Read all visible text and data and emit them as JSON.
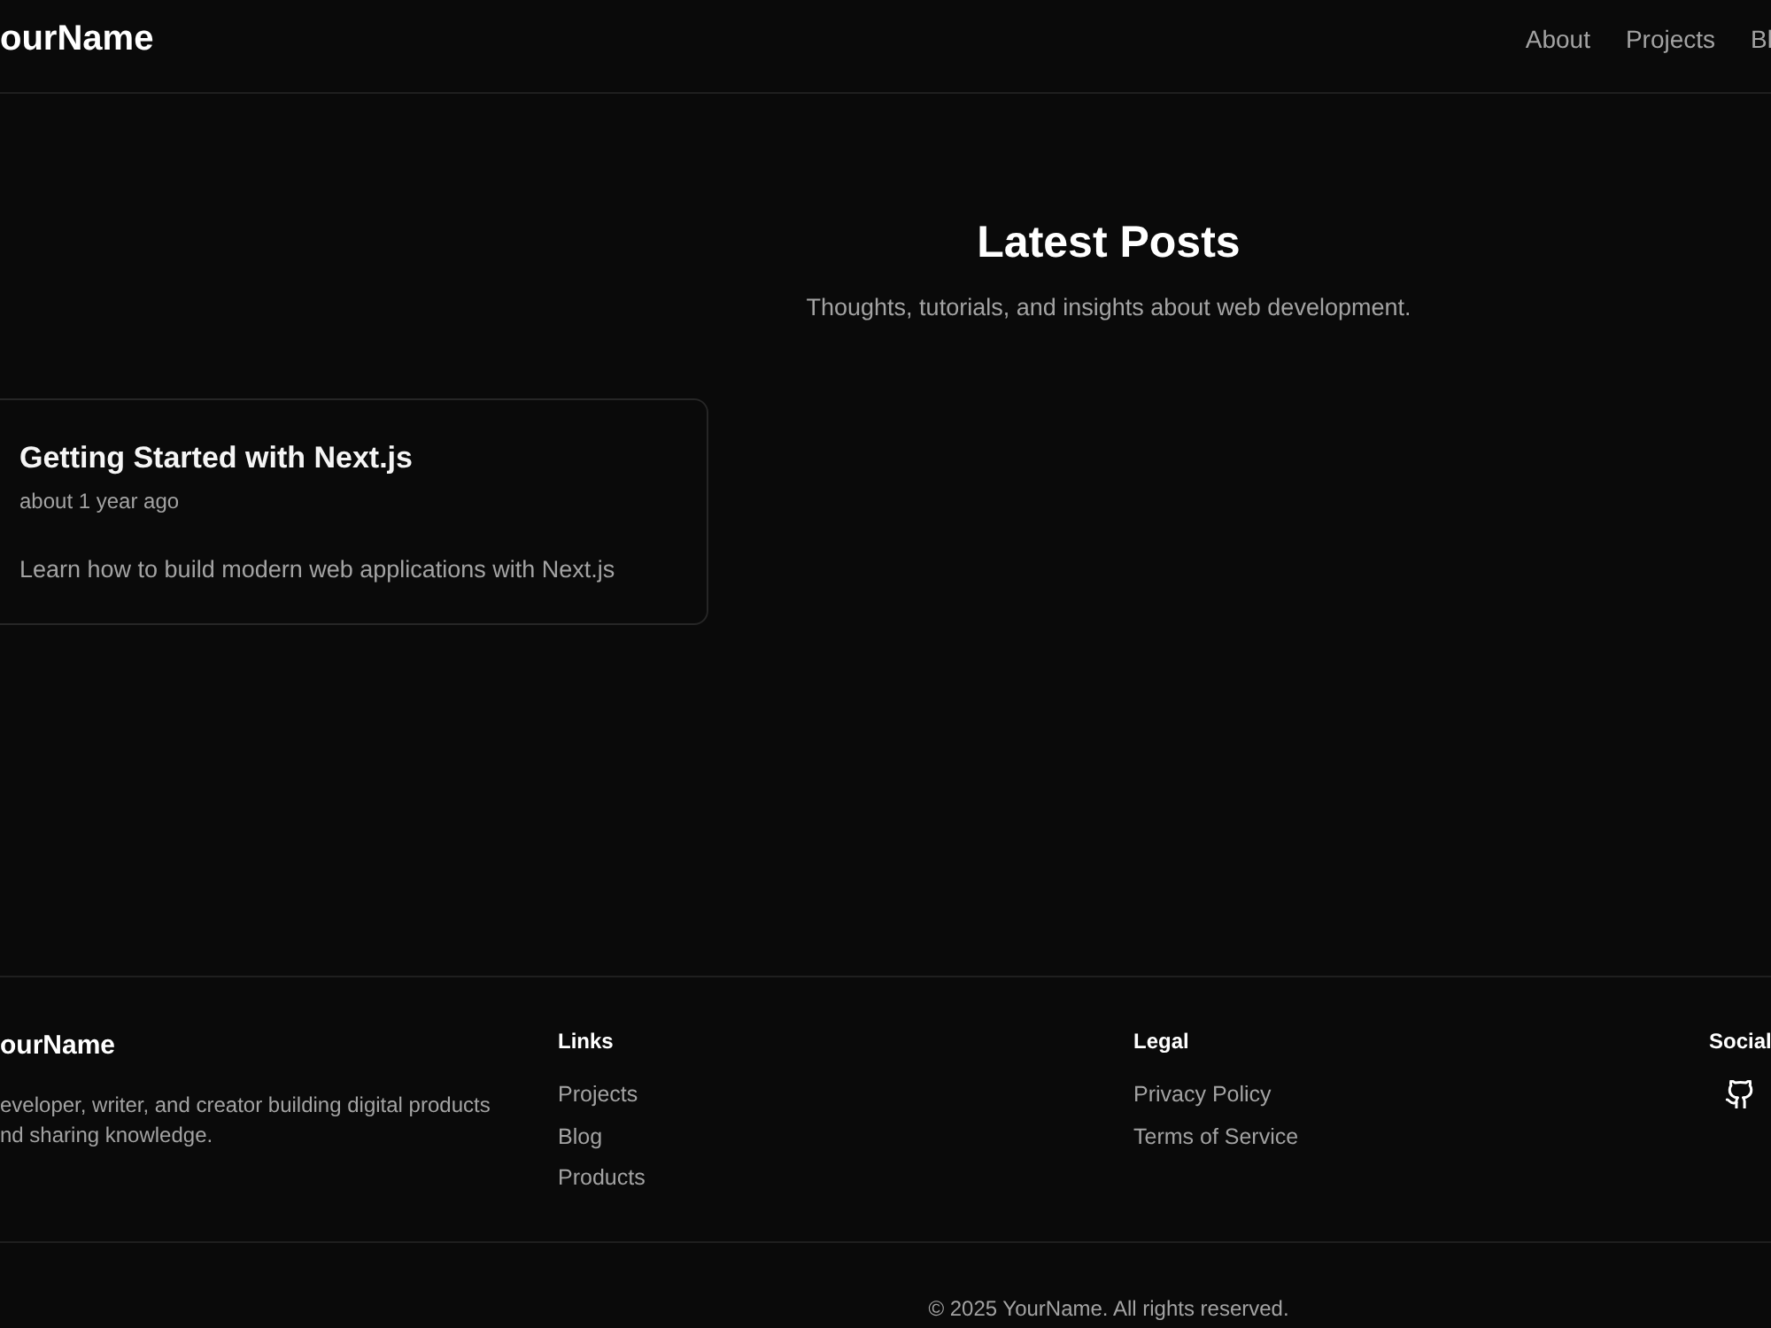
{
  "header": {
    "logo": "ourName",
    "nav": [
      {
        "label": "About"
      },
      {
        "label": "Projects"
      },
      {
        "label": "Bl"
      }
    ]
  },
  "hero": {
    "title": "Latest Posts",
    "subtitle": "Thoughts, tutorials, and insights about web development."
  },
  "posts": [
    {
      "title": "Getting Started with Next.js",
      "date": "about 1 year ago",
      "excerpt": "Learn how to build modern web applications with Next.js"
    }
  ],
  "footer": {
    "brand": "ourName",
    "description": "eveloper, writer, and creator building digital products nd sharing knowledge.",
    "columns": [
      {
        "heading": "Links",
        "links": [
          "Projects",
          "Blog",
          "Products"
        ]
      },
      {
        "heading": "Legal",
        "links": [
          "Privacy Policy",
          "Terms of Service"
        ]
      },
      {
        "heading": "Social",
        "icons": [
          {
            "kind": "github"
          }
        ]
      }
    ],
    "copyright": "© 2025 YourName. All rights reserved."
  }
}
